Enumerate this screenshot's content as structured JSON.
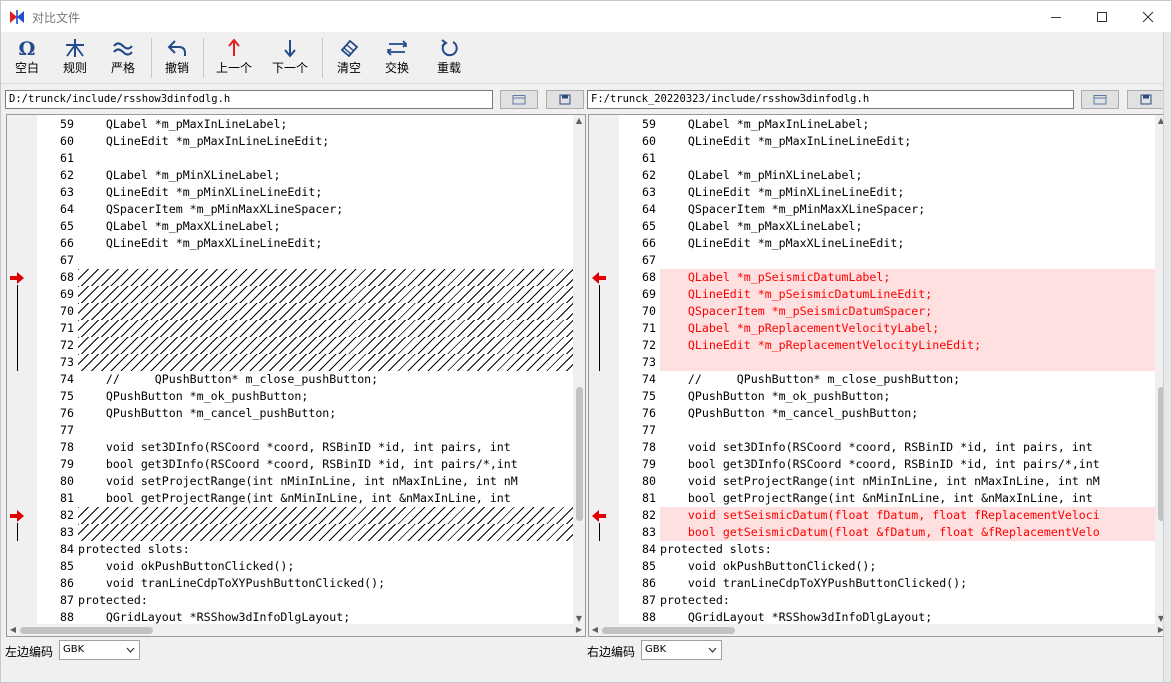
{
  "window": {
    "title": "对比文件"
  },
  "toolbar": {
    "buttons": [
      {
        "id": "whitespace",
        "label": "空白",
        "icon": "omega-icon"
      },
      {
        "id": "rules",
        "label": "规则",
        "icon": "rules-icon"
      },
      {
        "id": "strict",
        "label": "严格",
        "icon": "approx-icon"
      },
      {
        "id": "undo",
        "label": "撤销",
        "icon": "undo-icon"
      },
      {
        "id": "prev",
        "label": "上一个",
        "icon": "arrow-up-icon"
      },
      {
        "id": "next",
        "label": "下一个",
        "icon": "arrow-down-icon"
      },
      {
        "id": "clear",
        "label": "清空",
        "icon": "eraser-icon"
      },
      {
        "id": "swap",
        "label": "交换",
        "icon": "swap-icon"
      },
      {
        "id": "reload",
        "label": "重载",
        "icon": "reload-icon"
      }
    ]
  },
  "left": {
    "path": "D:/trunck/include/rsshow3dinfodlg.h",
    "encoding_label": "左边编码",
    "encoding": "GBK"
  },
  "right": {
    "path": "F:/trunck_20220323/include/rsshow3dinfodlg.h",
    "encoding_label": "右边编码",
    "encoding": "GBK"
  },
  "colors": {
    "diff_text": "#ff0000",
    "diff_bg": "#ffe0e0",
    "marker": "#e00000"
  },
  "lines": [
    {
      "n": "59",
      "left": "    QLabel *m_pMaxInLineLabel;",
      "right": "    QLabel *m_pMaxInLineLabel;",
      "kind": "same"
    },
    {
      "n": "60",
      "left": "    QLineEdit *m_pMaxInLineLineEdit;",
      "right": "    QLineEdit *m_pMaxInLineLineEdit;",
      "kind": "same"
    },
    {
      "n": "61",
      "left": "",
      "right": "",
      "kind": "same"
    },
    {
      "n": "62",
      "left": "    QLabel *m_pMinXLineLabel;",
      "right": "    QLabel *m_pMinXLineLabel;",
      "kind": "same"
    },
    {
      "n": "63",
      "left": "    QLineEdit *m_pMinXLineLineEdit;",
      "right": "    QLineEdit *m_pMinXLineLineEdit;",
      "kind": "same"
    },
    {
      "n": "64",
      "left": "    QSpacerItem *m_pMinMaxXLineSpacer;",
      "right": "    QSpacerItem *m_pMinMaxXLineSpacer;",
      "kind": "same"
    },
    {
      "n": "65",
      "left": "    QLabel *m_pMaxXLineLabel;",
      "right": "    QLabel *m_pMaxXLineLabel;",
      "kind": "same"
    },
    {
      "n": "66",
      "left": "    QLineEdit *m_pMaxXLineLineEdit;",
      "right": "    QLineEdit *m_pMaxXLineLineEdit;",
      "kind": "same"
    },
    {
      "n": "67",
      "left": "",
      "right": "",
      "kind": "same"
    },
    {
      "n": "68",
      "left": "",
      "right": "    QLabel *m_pSeismicDatumLabel;",
      "kind": "diff"
    },
    {
      "n": "69",
      "left": "",
      "right": "    QLineEdit *m_pSeismicDatumLineEdit;",
      "kind": "diff"
    },
    {
      "n": "70",
      "left": "",
      "right": "    QSpacerItem *m_pSeismicDatumSpacer;",
      "kind": "diff"
    },
    {
      "n": "71",
      "left": "",
      "right": "    QLabel *m_pReplacementVelocityLabel;",
      "kind": "diff"
    },
    {
      "n": "72",
      "left": "",
      "right": "    QLineEdit *m_pReplacementVelocityLineEdit;",
      "kind": "diff"
    },
    {
      "n": "73",
      "left": "",
      "right": "",
      "kind": "diff"
    },
    {
      "n": "74",
      "left": "    //     QPushButton* m_close_pushButton;",
      "right": "    //     QPushButton* m_close_pushButton;",
      "kind": "same"
    },
    {
      "n": "75",
      "left": "    QPushButton *m_ok_pushButton;",
      "right": "    QPushButton *m_ok_pushButton;",
      "kind": "same"
    },
    {
      "n": "76",
      "left": "    QPushButton *m_cancel_pushButton;",
      "right": "    QPushButton *m_cancel_pushButton;",
      "kind": "same"
    },
    {
      "n": "77",
      "left": "",
      "right": "",
      "kind": "same"
    },
    {
      "n": "78",
      "left": "    void set3DInfo(RSCoord *coord, RSBinID *id, int pairs, int",
      "right": "    void set3DInfo(RSCoord *coord, RSBinID *id, int pairs, int",
      "kind": "same"
    },
    {
      "n": "79",
      "left": "    bool get3DInfo(RSCoord *coord, RSBinID *id, int pairs/*,int",
      "right": "    bool get3DInfo(RSCoord *coord, RSBinID *id, int pairs/*,int",
      "kind": "same"
    },
    {
      "n": "80",
      "left": "    void setProjectRange(int nMinInLine, int nMaxInLine, int nM",
      "right": "    void setProjectRange(int nMinInLine, int nMaxInLine, int nM",
      "kind": "same"
    },
    {
      "n": "81",
      "left": "    bool getProjectRange(int &nMinInLine, int &nMaxInLine, int",
      "right": "    bool getProjectRange(int &nMinInLine, int &nMaxInLine, int",
      "kind": "same"
    },
    {
      "n": "82",
      "left": "",
      "right": "    void setSeismicDatum(float fDatum, float fReplacementVeloci",
      "kind": "diff"
    },
    {
      "n": "83",
      "left": "",
      "right": "    bool getSeismicDatum(float &fDatum, float &fReplacementVelo",
      "kind": "diff"
    },
    {
      "n": "84",
      "left": "protected slots:",
      "right": "protected slots:",
      "kind": "same"
    },
    {
      "n": "85",
      "left": "    void okPushButtonClicked();",
      "right": "    void okPushButtonClicked();",
      "kind": "same"
    },
    {
      "n": "86",
      "left": "    void tranLineCdpToXYPushButtonClicked();",
      "right": "    void tranLineCdpToXYPushButtonClicked();",
      "kind": "same"
    },
    {
      "n": "87",
      "left": "protected:",
      "right": "protected:",
      "kind": "same"
    },
    {
      "n": "88",
      "left": "    QGridLayout *RSShow3dInfoDlgLayout;",
      "right": "    QGridLayout *RSShow3dInfoDlgLayout;",
      "kind": "same"
    }
  ]
}
